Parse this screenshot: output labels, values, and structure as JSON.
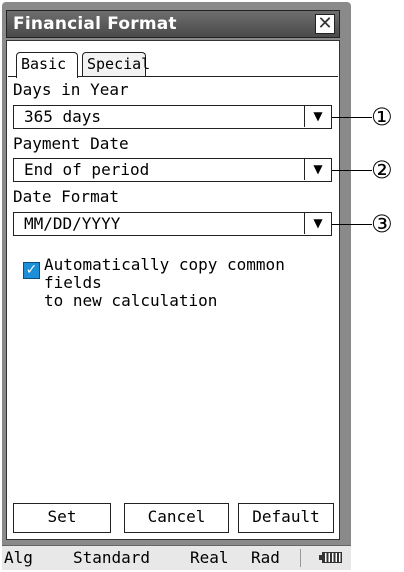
{
  "window": {
    "title": "Financial Format",
    "close_glyph": "✕"
  },
  "tabs": [
    {
      "label": "Basic"
    },
    {
      "label": "Special"
    }
  ],
  "fields": {
    "days_in_year": {
      "label": "Days in Year",
      "value": "365 days",
      "callout": "①"
    },
    "payment_date": {
      "label": "Payment Date",
      "value": "End of period",
      "callout": "②"
    },
    "date_format": {
      "label": "Date Format",
      "value": "MM/DD/YYYY",
      "callout": "③"
    }
  },
  "option": {
    "label_line1": "Automatically copy common fields",
    "label_line2": "to new calculation",
    "checked": true
  },
  "buttons": {
    "set": "Set",
    "cancel": "Cancel",
    "default": "Default"
  },
  "statusbar": {
    "mode": "Alg",
    "display": "Standard",
    "number": "Real",
    "angle": "Rad"
  },
  "icons": {
    "dropdown": "chevron-down-icon",
    "battery": "battery-icon",
    "close": "close-icon"
  },
  "colors": {
    "checkbox": "#1d8fd8",
    "title_bg": "#5a5a5a",
    "frame": "#8a8a8a"
  }
}
